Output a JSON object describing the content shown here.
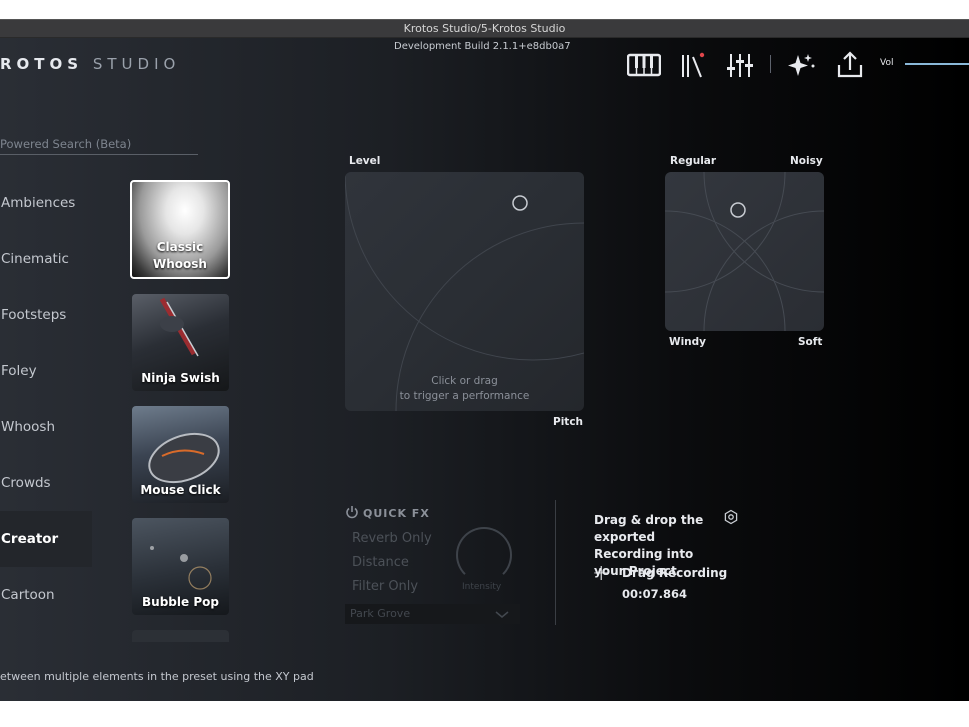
{
  "window": {
    "title": "Krotos Studio/5-Krotos Studio",
    "build": "Development Build 2.1.1+e8db0a7"
  },
  "logo": {
    "bold": "ROTOS",
    "light": "STUDIO"
  },
  "toolbar": {
    "icons": [
      "keyboard-icon",
      "library-icon",
      "mixer-icon",
      "sparkle-icon",
      "export-icon"
    ],
    "vol_label": "Vol",
    "accent": "#8ab8d8",
    "notification_dot": "#e0464b"
  },
  "search": {
    "placeholder": "Powered Search (Beta)",
    "value": ""
  },
  "categories": [
    {
      "label": "Ambiences"
    },
    {
      "label": "Cinematic"
    },
    {
      "label": "Footsteps"
    },
    {
      "label": "Foley"
    },
    {
      "label": "Whoosh"
    },
    {
      "label": "Crowds"
    },
    {
      "label": "Creator",
      "active": true
    },
    {
      "label": "Cartoon"
    }
  ],
  "presets": [
    {
      "label": "Classic Whoosh",
      "selected": true
    },
    {
      "label": "Ninja Swish"
    },
    {
      "label": "Mouse Click"
    },
    {
      "label": "Bubble Pop"
    }
  ],
  "performance_pad": {
    "y_label": "Level",
    "x_label": "Pitch",
    "hint_line1": "Click or drag",
    "hint_line2": "to trigger a performance"
  },
  "timbre_pad": {
    "top_left": "Regular",
    "top_right": "Noisy",
    "bottom_left": "Windy",
    "bottom_right": "Soft"
  },
  "quick_fx": {
    "title": "QUICK FX",
    "items": [
      "Reverb Only",
      "Distance",
      "Filter Only"
    ],
    "knob_label": "Intensity",
    "preset": "Park Grove"
  },
  "recording": {
    "instructions": "Drag & drop the exported Recording into your Project",
    "drag_label": "Drag Recording",
    "duration": "00:07.864"
  },
  "footer": {
    "text": "etween multiple elements in the preset using the XY pad"
  }
}
